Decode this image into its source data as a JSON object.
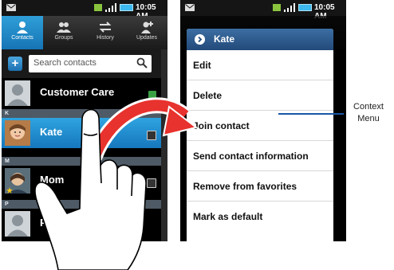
{
  "status_bar": {
    "time": "10:05 AM"
  },
  "tabs": [
    {
      "label": "Contacts",
      "icon": "person-icon"
    },
    {
      "label": "Groups",
      "icon": "group-icon"
    },
    {
      "label": "History",
      "icon": "history-icon"
    },
    {
      "label": "Updates",
      "icon": "updates-icon"
    }
  ],
  "search": {
    "placeholder": "Search contacts"
  },
  "contacts": [
    {
      "name": "Customer Care"
    },
    {
      "section": "K",
      "name": "Kate"
    },
    {
      "section": "M",
      "name": "Mom"
    },
    {
      "section": "P",
      "name": "Pat"
    }
  ],
  "context_menu": {
    "title": "Kate",
    "items": [
      "Edit",
      "Delete",
      "Join contact",
      "Send contact information",
      "Remove from favorites",
      "Mark as default"
    ]
  },
  "callout": {
    "line1": "Context",
    "line2": "Menu"
  },
  "colors": {
    "accent": "#1d87cc",
    "arrow": "#e8322e",
    "menu_title": "#2c5a8e",
    "callout_line": "#1a57a6"
  }
}
